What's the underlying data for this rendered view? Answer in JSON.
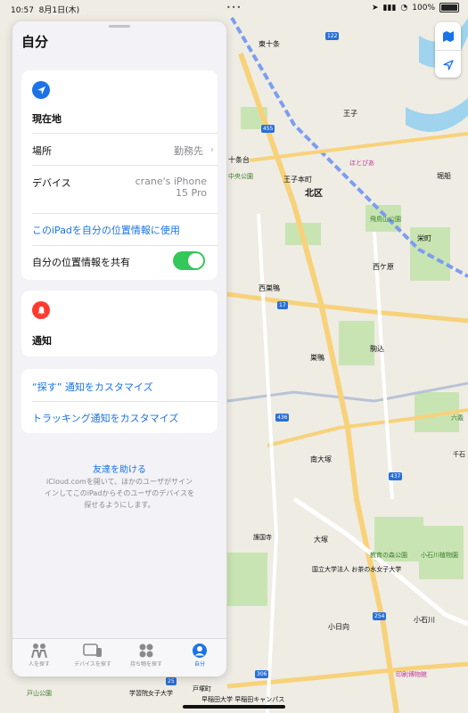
{
  "status_bar": {
    "time": "10:57",
    "date": "8月1日(木)",
    "battery": "100%"
  },
  "sheet": {
    "title": "自分",
    "location_card": {
      "heading": "現在地",
      "place_label": "場所",
      "place_value": "勤務先",
      "device_label": "デバイス",
      "device_value_line1": "crane's iPhone",
      "device_value_line2": "15 Pro",
      "use_ipad_link": "このiPadを自分の位置情報に使用",
      "share_label": "自分の位置情報を共有",
      "share_on": true
    },
    "notifications_card": {
      "heading": "通知"
    },
    "customize_card": {
      "find_my_link": "“探す” 通知をカスタマイズ",
      "tracking_link": "トラッキング通知をカスタマイズ"
    },
    "help": {
      "title": "友達を助ける",
      "body_line1": "iCloud.comを開いて、ほかのユーザがサイン",
      "body_line2": "インしてこのiPadからそのユーザのデバイスを",
      "body_line3": "探せるようにします。"
    },
    "tabs": [
      {
        "label": "人を探す",
        "icon": "people-icon"
      },
      {
        "label": "デバイスを探す",
        "icon": "devices-icon"
      },
      {
        "label": "持ち物を探す",
        "icon": "items-icon"
      },
      {
        "label": "自分",
        "icon": "person-icon",
        "active": true
      }
    ]
  },
  "map": {
    "labels": {
      "higashi_jujo": "東十条",
      "oji": "王子",
      "jujodai": "十条台",
      "oji_honcho": "王子本町",
      "kita_ku": "北区",
      "chuo_koen": "中央公園",
      "asukayama": "飛鳥山公園",
      "horifune": "堀船",
      "sakaecho": "栄町",
      "nishigahara": "西ケ原",
      "nishisugamo": "西巣鴨",
      "sugamo": "巣鴨",
      "komagome": "駒込",
      "minami_otsuka": "南大塚",
      "otsuka": "大塚",
      "kyoiku_no_mori": "教育の森公園",
      "koishikawa_garden": "小石川植物園",
      "ochanomizu": "国立大学法人 お茶の水女子大学",
      "koishikawa": "小石川",
      "kohinata": "小日向",
      "insatsu": "印刷博物館",
      "gokoku": "護国寺",
      "toyama": "戸山公園",
      "gakushuin": "学習院女子大学",
      "waseda": "早稲田大学 早稲田キャンパス",
      "totsuka": "戸塚町",
      "hotobia": "ほとぴあ",
      "rikugien": "六義",
      "sengoku": "千石",
      "n122": "122",
      "n455": "455",
      "n17": "17",
      "n436": "436",
      "n437": "437",
      "n254": "254",
      "n25": "25",
      "n306": "306"
    }
  }
}
